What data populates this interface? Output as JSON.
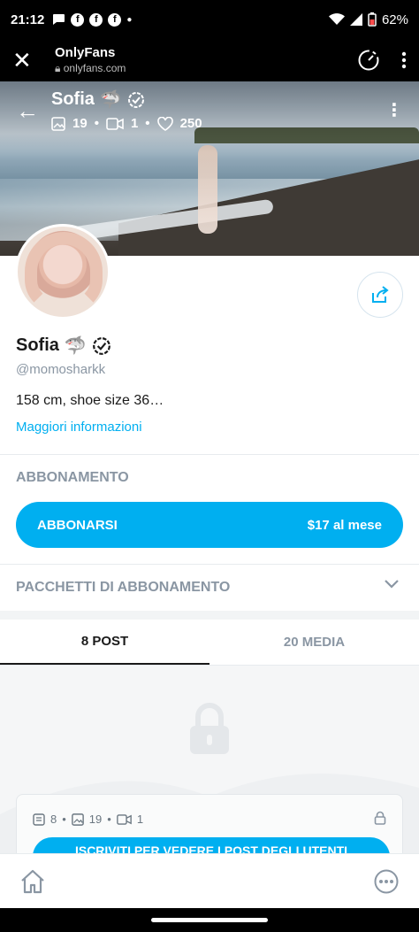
{
  "status_bar": {
    "time": "21:12",
    "battery": "62%",
    "icons": [
      "message-bubble-icon",
      "facebook-icon",
      "facebook-icon",
      "facebook-icon",
      "wifi-icon",
      "signal-icon",
      "battery-icon"
    ]
  },
  "browser": {
    "title": "OnlyFans",
    "url": "onlyfans.com"
  },
  "cover": {
    "name": "Sofia",
    "emoji": "🦈",
    "photos": "19",
    "videos": "1",
    "likes": "250"
  },
  "profile": {
    "name": "Sofia",
    "emoji": "🦈",
    "handle": "@momosharkk",
    "bio": "158 cm, shoe size 36…",
    "more_info": "Maggiori informazioni"
  },
  "subscription": {
    "title": "ABBONAMENTO",
    "button_label": "ABBONARSI",
    "price": "$17 al mese"
  },
  "bundles": {
    "title": "PACCHETTI DI ABBONAMENTO"
  },
  "tabs": [
    {
      "label": "8 POST",
      "active": true
    },
    {
      "label": "20 MEDIA",
      "active": false
    }
  ],
  "locked_card": {
    "posts": "8",
    "photos": "19",
    "videos": "1",
    "cta": "ISCRIVITI PER VEDERE I POST DEGLI UTENTI"
  },
  "colors": {
    "accent": "#00aff0",
    "muted": "#8a96a3"
  }
}
